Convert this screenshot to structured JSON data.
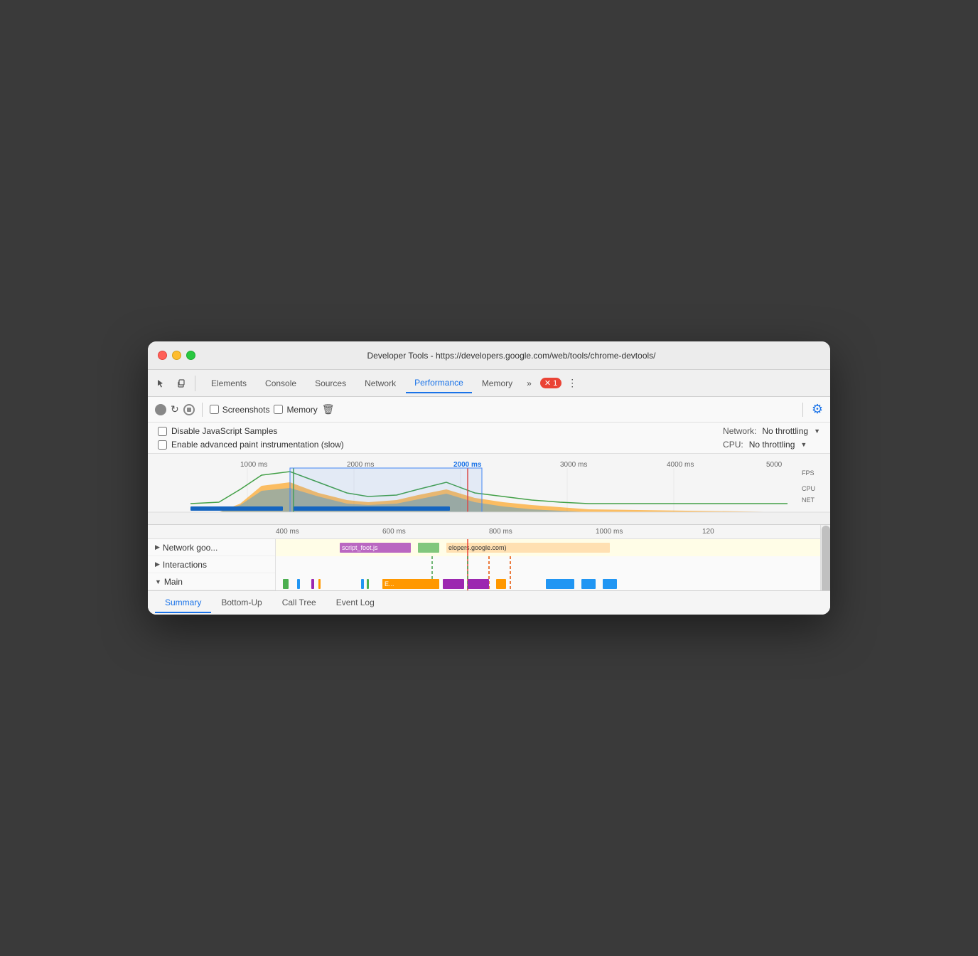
{
  "window": {
    "title": "Developer Tools - https://developers.google.com/web/tools/chrome-devtools/"
  },
  "tabs": {
    "items": [
      {
        "label": "Elements",
        "active": false
      },
      {
        "label": "Console",
        "active": false
      },
      {
        "label": "Sources",
        "active": false
      },
      {
        "label": "Network",
        "active": false
      },
      {
        "label": "Performance",
        "active": true
      },
      {
        "label": "Memory",
        "active": false
      }
    ],
    "more_label": "»",
    "error_count": "1",
    "dots_label": "⋮"
  },
  "toolbar2": {
    "screenshots_label": "Screenshots",
    "memory_label": "Memory"
  },
  "options": {
    "disable_js_samples": "Disable JavaScript Samples",
    "enable_paint": "Enable advanced paint instrumentation (slow)",
    "network_label": "Network:",
    "network_value": "No throttling",
    "cpu_label": "CPU:",
    "cpu_value": "No throttling"
  },
  "timeline": {
    "marks": [
      "1000 ms",
      "2000 ms",
      "3000 ms",
      "4000 ms",
      "5000"
    ],
    "fps_label": "FPS",
    "cpu_label": "CPU",
    "net_label": "NET"
  },
  "flamechart": {
    "ruler_marks": [
      "400 ms",
      "600 ms",
      "800 ms",
      "1000 ms",
      "120"
    ],
    "rows": [
      {
        "label": "▶ Network goo...",
        "indent": 0,
        "expanded": false
      },
      {
        "label": "Interactions",
        "indent": 0,
        "expanded": false,
        "prefix": "▶"
      },
      {
        "label": "Main",
        "indent": 0,
        "expanded": true,
        "prefix": "▼"
      }
    ],
    "network_items": [
      "script_foot.js",
      "elopers.google.com)"
    ]
  },
  "bottom_tabs": {
    "items": [
      {
        "label": "Summary",
        "active": true
      },
      {
        "label": "Bottom-Up",
        "active": false
      },
      {
        "label": "Call Tree",
        "active": false
      },
      {
        "label": "Event Log",
        "active": false
      }
    ]
  }
}
